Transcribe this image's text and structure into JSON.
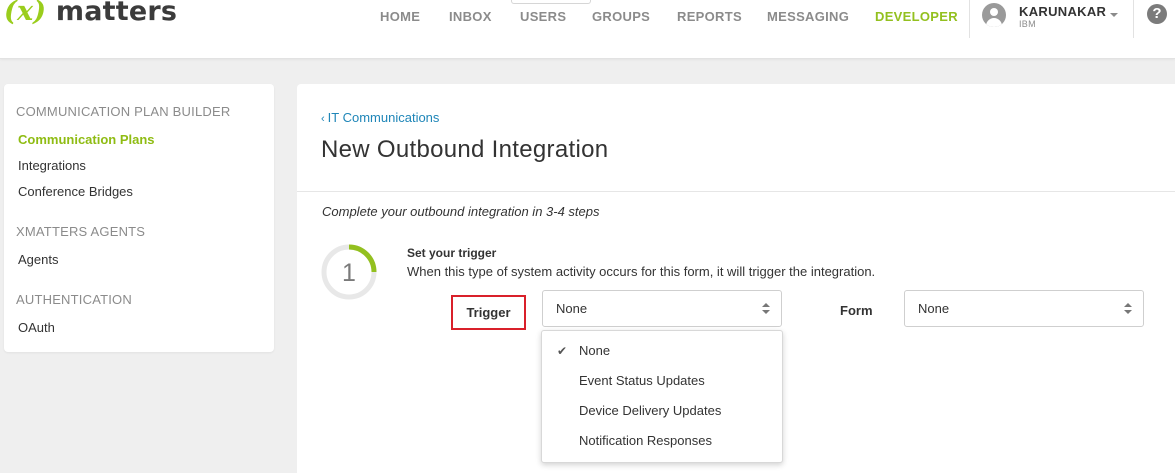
{
  "app": {
    "logo_x": "(x)",
    "logo_text": "matters"
  },
  "nav": {
    "items": [
      "HOME",
      "INBOX",
      "USERS",
      "GROUPS",
      "REPORTS",
      "MESSAGING",
      "DEVELOPER"
    ],
    "active": "DEVELOPER"
  },
  "user": {
    "name": "KARUNAKAR",
    "org": "IBM"
  },
  "help": {
    "icon_glyph": "?"
  },
  "sidebar": {
    "sections": [
      {
        "heading": "COMMUNICATION PLAN BUILDER",
        "items": [
          "Communication Plans",
          "Integrations",
          "Conference Bridges"
        ]
      },
      {
        "heading": "XMATTERS AGENTS",
        "items": [
          "Agents"
        ]
      },
      {
        "heading": "AUTHENTICATION",
        "items": [
          "OAuth"
        ]
      }
    ],
    "active_item": "Communication Plans"
  },
  "main": {
    "breadcrumb": "IT Communications",
    "breadcrumb_chevron": "‹",
    "title": "New Outbound Integration",
    "steps_note": "Complete your outbound integration in 3-4 steps",
    "step": {
      "number": "1",
      "title": "Set your trigger",
      "description": "When this type of system activity occurs for this form, it will trigger the integration."
    },
    "trigger": {
      "label": "Trigger",
      "value": "None"
    },
    "form": {
      "label": "Form",
      "value": "None"
    },
    "trigger_options": [
      "None",
      "Event Status Updates",
      "Device Delivery Updates",
      "Notification Responses"
    ],
    "selected_option": "None",
    "check_glyph": "✔"
  },
  "colors": {
    "brand_green": "#93c01f",
    "link_blue": "#1f86b8",
    "highlight_red": "#d9202a"
  }
}
